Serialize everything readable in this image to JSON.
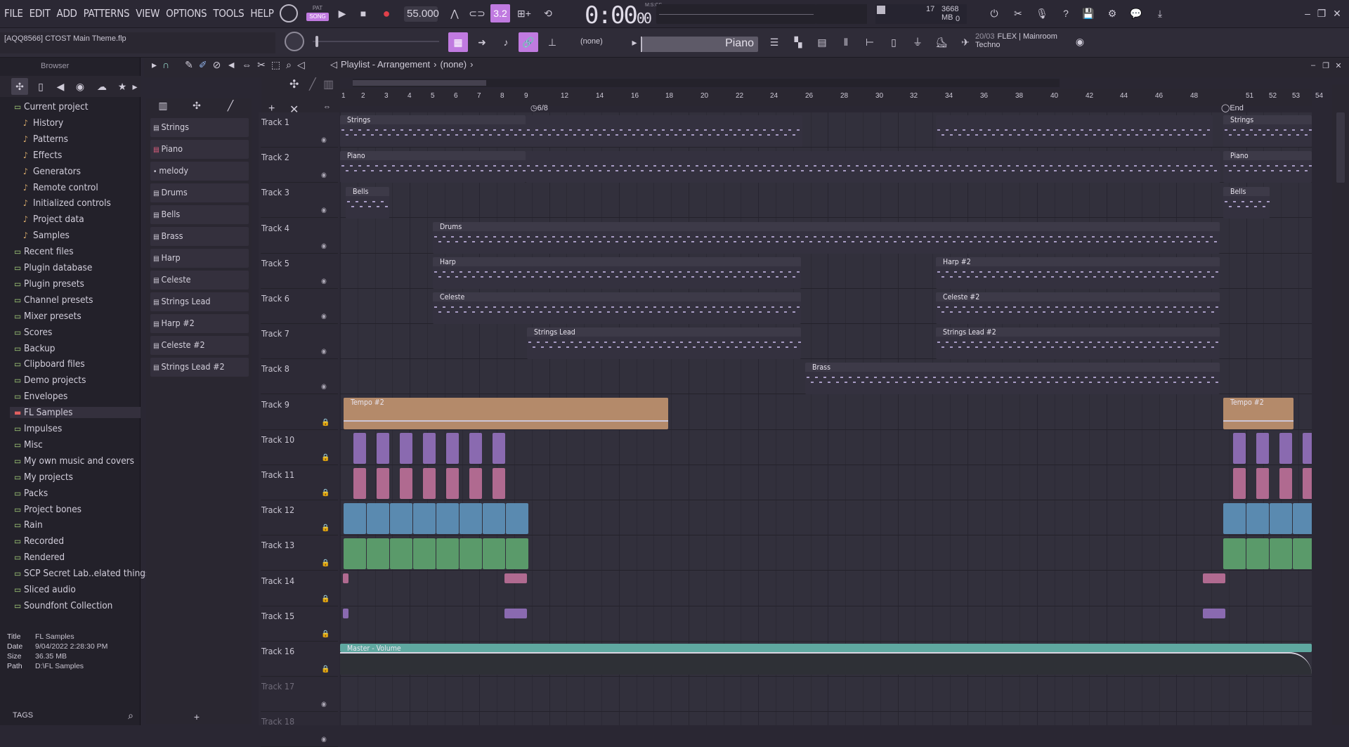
{
  "menu": [
    "FILE",
    "EDIT",
    "ADD",
    "PATTERNS",
    "VIEW",
    "OPTIONS",
    "TOOLS",
    "HELP"
  ],
  "transport": {
    "pat_label": "PAT",
    "song_label": "SONG",
    "tempo": "55.000",
    "time": "0:00",
    "time_sub": "00",
    "time_unit": "M:S:CS",
    "step": "3.2"
  },
  "meters": {
    "cpu": "17",
    "memory": "3668 MB",
    "voices": "0"
  },
  "project": {
    "name": "[AQQ8566] CTOST Main Theme.flp"
  },
  "pattern_picker": {
    "none_label": "(none)",
    "current": "Piano"
  },
  "news": {
    "date": "20/03",
    "line1": "FLEX | Mainroom",
    "line2": "Techno"
  },
  "browser": {
    "title": "Browser",
    "items": [
      {
        "label": "Current project",
        "level": 0
      },
      {
        "label": "History",
        "level": 1
      },
      {
        "label": "Patterns",
        "level": 1
      },
      {
        "label": "Effects",
        "level": 1
      },
      {
        "label": "Generators",
        "level": 1
      },
      {
        "label": "Remote control",
        "level": 1
      },
      {
        "label": "Initialized controls",
        "level": 1
      },
      {
        "label": "Project data",
        "level": 1
      },
      {
        "label": "Samples",
        "level": 1
      },
      {
        "label": "Recent files",
        "level": 0
      },
      {
        "label": "Plugin database",
        "level": 0
      },
      {
        "label": "Plugin presets",
        "level": 0
      },
      {
        "label": "Channel presets",
        "level": 0
      },
      {
        "label": "Mixer presets",
        "level": 0
      },
      {
        "label": "Scores",
        "level": 0
      },
      {
        "label": "Backup",
        "level": 0
      },
      {
        "label": "Clipboard files",
        "level": 0
      },
      {
        "label": "Demo projects",
        "level": 0
      },
      {
        "label": "Envelopes",
        "level": 0
      },
      {
        "label": "FL Samples",
        "level": 0
      },
      {
        "label": "Impulses",
        "level": 0
      },
      {
        "label": "Misc",
        "level": 0
      },
      {
        "label": "My own music and covers",
        "level": 0
      },
      {
        "label": "My projects",
        "level": 0
      },
      {
        "label": "Packs",
        "level": 0
      },
      {
        "label": "Project bones",
        "level": 0
      },
      {
        "label": "Rain",
        "level": 0
      },
      {
        "label": "Recorded",
        "level": 0
      },
      {
        "label": "Rendered",
        "level": 0
      },
      {
        "label": "SCP Secret Lab..elated things",
        "level": 0
      },
      {
        "label": "Sliced audio",
        "level": 0
      },
      {
        "label": "Soundfont Collection",
        "level": 0
      }
    ],
    "fileinfo": {
      "title_k": "Title",
      "title_v": "FL Samples",
      "date_k": "Date",
      "date_v": "9/04/2022 2:28:30 PM",
      "size_k": "Size",
      "size_v": "36.35 MB",
      "path_k": "Path",
      "path_v": "D:\\FL Samples"
    },
    "tags_label": "TAGS"
  },
  "channels": [
    "Strings",
    "Piano",
    "melody",
    "Drums",
    "Bells",
    "Brass",
    "Harp",
    "Celeste",
    "Strings Lead",
    "Harp #2",
    "Celeste #2",
    "Strings Lead #2"
  ],
  "playlist": {
    "title": "Playlist - Arrangement",
    "sep": "›",
    "pattern": "(none)",
    "marker_time": "6/8",
    "marker_end": "End"
  },
  "ruler": [
    "1",
    "2",
    "3",
    "4",
    "5",
    "6",
    "7",
    "8",
    "9",
    "12",
    "14",
    "16",
    "18",
    "20",
    "22",
    "24",
    "26",
    "28",
    "30",
    "32",
    "34",
    "36",
    "38",
    "40",
    "42",
    "44",
    "46",
    "48",
    "51",
    "52",
    "53",
    "54"
  ],
  "tracks": [
    "Track 1",
    "Track 2",
    "Track 3",
    "Track 4",
    "Track 5",
    "Track 6",
    "Track 7",
    "Track 8",
    "Track 9",
    "Track 10",
    "Track 11",
    "Track 12",
    "Track 13",
    "Track 14",
    "Track 15",
    "Track 16",
    "Track 17",
    "Track 18"
  ],
  "clips": {
    "strings": "Strings",
    "piano": "Piano",
    "bells": "Bells",
    "drums": "Drums",
    "harp": "Harp",
    "harp2": "Harp #2",
    "celeste": "Celeste",
    "celeste2": "Celeste #2",
    "slead": "Strings Lead",
    "slead2": "Strings Lead #2",
    "brass": "Brass",
    "tempo": "Tempo #2",
    "master": "Master - Volume"
  },
  "colors": {
    "accent": "#c07ae0",
    "clip_note": "#3a3848",
    "tempo_clip": "#b48a6a",
    "master_clip": "#5fa8a0",
    "auto_purple": "#8a6ab0",
    "auto_pink": "#b06a90",
    "auto_blue": "#5a8ab0",
    "auto_green": "#5a9a6a"
  }
}
